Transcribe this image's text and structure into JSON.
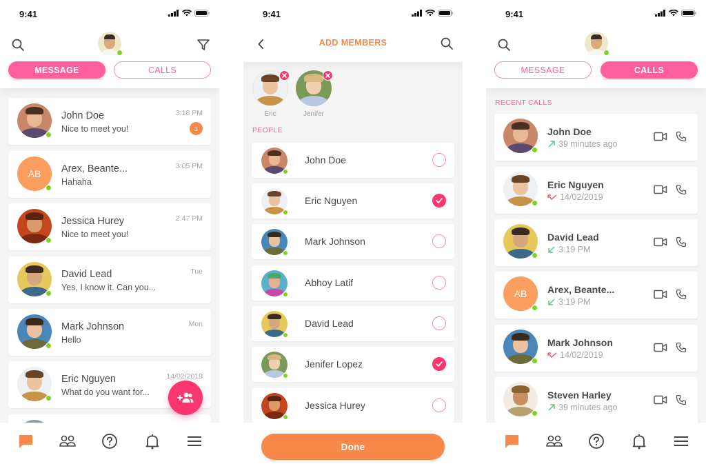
{
  "status_bar": {
    "time": "9:41"
  },
  "colors": {
    "accent_pink": "#ff5f9b",
    "fab_pink": "#f9376e",
    "accent_orange": "#f6884a",
    "avatar_orange": "#fb9d5e",
    "online_green": "#7ed321",
    "outgoing_green": "#5cc68a",
    "missed_red": "#f5606b"
  },
  "messages_screen": {
    "tabs": [
      {
        "label": "MESSAGE",
        "active": true
      },
      {
        "label": "CALLS",
        "active": false
      }
    ],
    "conversations": [
      {
        "name": "John Doe",
        "preview": "Nice to meet you!",
        "time": "3:18 PM",
        "unread": "1",
        "avatar": "photo-john",
        "online": true
      },
      {
        "name": "Arex, Beante...",
        "preview": "Hahaha",
        "time": "3:05 PM",
        "avatar_initials": "AB",
        "online": true
      },
      {
        "name": "Jessica Hurey",
        "preview": "Nice to meet you!",
        "time": "2:47 PM",
        "avatar": "photo-jessica",
        "online": true
      },
      {
        "name": "David Lead",
        "preview": "Yes, I know it. Can you...",
        "time": "Tue",
        "avatar": "photo-david",
        "online": true
      },
      {
        "name": "Mark Johnson",
        "preview": "Hello",
        "time": "Mon",
        "avatar": "photo-mark",
        "online": true
      },
      {
        "name": "Eric Nguyen",
        "preview": "What do you want for...",
        "time": "14/02/2019",
        "avatar": "photo-eric",
        "online": true
      }
    ],
    "fab_icon": "add-group-icon"
  },
  "add_members_screen": {
    "title": "ADD MEMBERS",
    "selected": [
      {
        "name": "Eric",
        "avatar": "photo-eric"
      },
      {
        "name": "Jenifer",
        "avatar": "photo-jenifer"
      }
    ],
    "section_label": "PEOPLE",
    "people": [
      {
        "name": "John Doe",
        "checked": false
      },
      {
        "name": "Eric Nguyen",
        "checked": true
      },
      {
        "name": "Mark Johnson",
        "checked": false
      },
      {
        "name": "Abhoy Latif",
        "checked": false
      },
      {
        "name": "David Lead",
        "checked": false
      },
      {
        "name": "Jenifer Lopez",
        "checked": true
      },
      {
        "name": "Jessica Hurey",
        "checked": false
      }
    ],
    "done_label": "Done"
  },
  "calls_screen": {
    "tabs": [
      {
        "label": "MESSAGE",
        "active": false
      },
      {
        "label": "CALLS",
        "active": true
      }
    ],
    "section_label": "RECENT CALLS",
    "calls": [
      {
        "name": "John Doe",
        "type": "outgoing",
        "time": "39 minutes ago"
      },
      {
        "name": "Eric Nguyen",
        "type": "missed",
        "time": "14/02/2019"
      },
      {
        "name": "David Lead",
        "type": "incoming",
        "time": "3:19 PM"
      },
      {
        "name": "Arex, Beante...",
        "type": "incoming",
        "time": "3:19 PM",
        "avatar_initials": "AB"
      },
      {
        "name": "Mark Johnson",
        "type": "missed",
        "time": "14/02/2019"
      },
      {
        "name": "Steven Harley",
        "type": "outgoing",
        "time": "39 minutes ago"
      }
    ]
  },
  "bottom_nav": [
    {
      "icon": "chat-icon",
      "active": true
    },
    {
      "icon": "contacts-icon",
      "active": false
    },
    {
      "icon": "help-icon",
      "active": false
    },
    {
      "icon": "bell-icon",
      "active": false
    },
    {
      "icon": "menu-icon",
      "active": false
    }
  ]
}
